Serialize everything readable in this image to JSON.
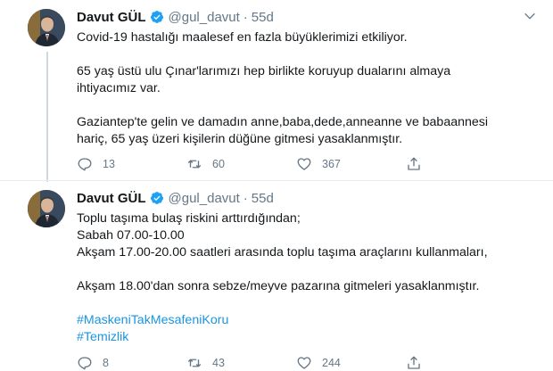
{
  "tweets": [
    {
      "name": "Davut GÜL",
      "handle": "@gul_davut",
      "separator": "·",
      "time": "55d",
      "lines": [
        "Covid-19 hastalığı maalesef en fazla büyüklerimizi etkiliyor.",
        "",
        "65 yaş üstü ulu Çınar'larımızı hep birlikte koruyup dualarını almaya",
        "ihtiyacımız var.",
        "",
        "Gaziantep'te gelin ve damadın anne,baba,dede,anneanne ve babaannesi",
        "hariç, 65 yaş üzeri kişilerin düğüne gitmesi yasaklanmıştır."
      ],
      "hashtags": [],
      "replies": "13",
      "retweets": "60",
      "likes": "367"
    },
    {
      "name": "Davut GÜL",
      "handle": "@gul_davut",
      "separator": "·",
      "time": "55d",
      "lines": [
        "Toplu taşıma bulaş riskini arttırdığından;",
        "Sabah 07.00-10.00",
        "Akşam 17.00-20.00 saatleri arasında toplu taşıma araçlarını kullanmaları,",
        "",
        "Akşam 18.00'dan sonra sebze/meyve pazarına gitmeleri yasaklanmıştır."
      ],
      "hashtags": [
        "#MaskeniTakMesafeniKoru",
        "#Temizlik"
      ],
      "replies": "8",
      "retweets": "43",
      "likes": "244"
    }
  ],
  "colors": {
    "link": "#1b95e0",
    "muted": "#657786",
    "verified": "#1da1f2"
  },
  "icons": [
    "reply-icon",
    "retweet-icon",
    "like-icon",
    "share-icon",
    "verified-badge-icon",
    "chevron-down-icon"
  ]
}
